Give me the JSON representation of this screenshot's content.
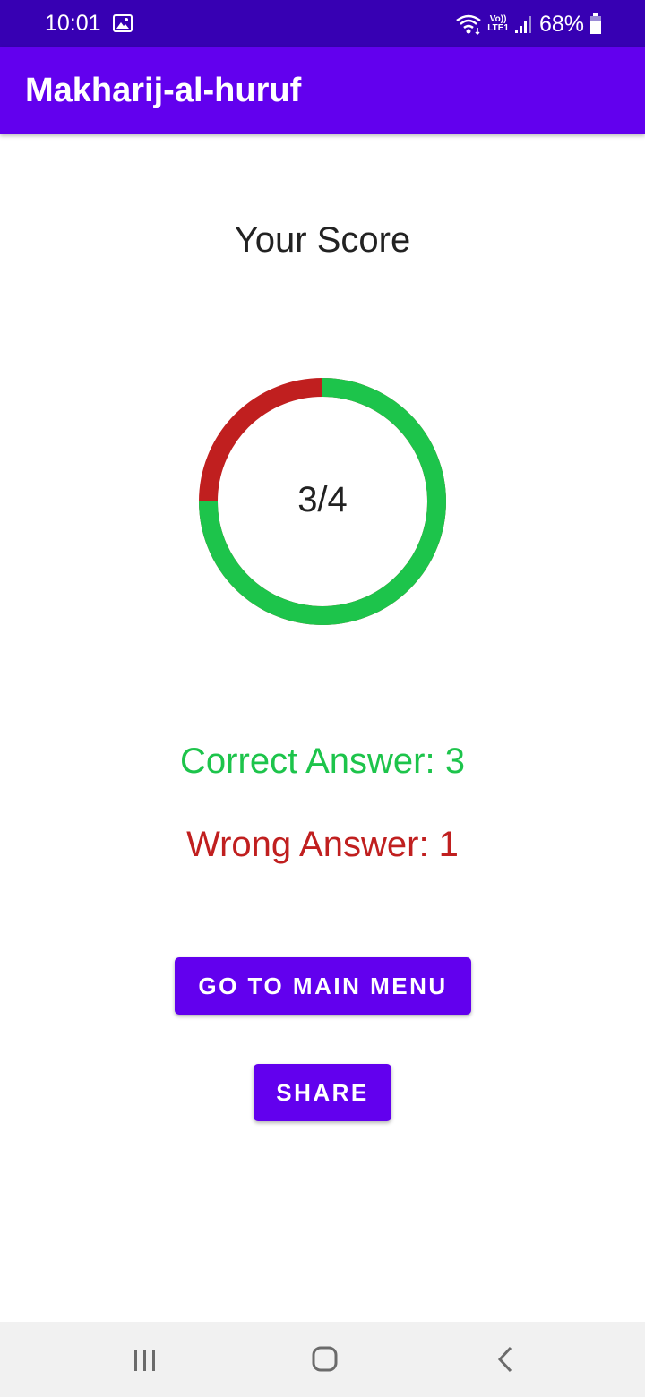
{
  "status_bar": {
    "time": "10:01",
    "lte_top": "Vo))",
    "lte_bottom": "LTE1",
    "battery": "68%"
  },
  "app_bar": {
    "title": "Makharij-al-huruf"
  },
  "score": {
    "heading": "Your Score",
    "ring_label": "3/4",
    "correct": 3,
    "total": 4,
    "correct_text": "Correct Answer: 3",
    "wrong_text": "Wrong Answer: 1"
  },
  "buttons": {
    "main_menu": "GO TO MAIN MENU",
    "share": "SHARE"
  },
  "colors": {
    "status_bar": "#3700b3",
    "primary": "#6200ee",
    "correct": "#1dc44b",
    "wrong": "#c01f1f"
  },
  "icons": {
    "gallery": "gallery-icon",
    "wifi": "wifi-icon",
    "signal": "signal-icon",
    "battery": "battery-icon",
    "recents": "recents-icon",
    "home": "home-icon",
    "back": "back-icon"
  }
}
